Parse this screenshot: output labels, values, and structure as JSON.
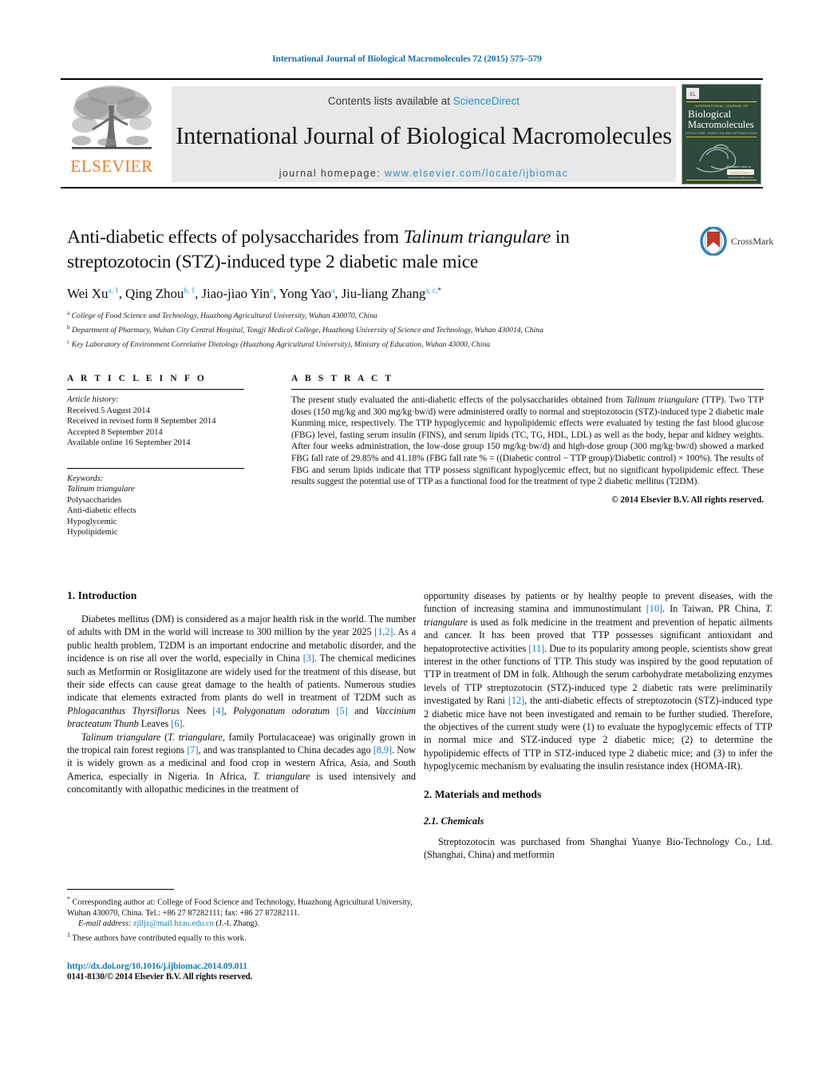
{
  "running_head": "International Journal of Biological Macromolecules 72 (2015) 575–579",
  "masthead": {
    "publisher_name": "ELSEVIER",
    "contents_prefix": "Contents lists available at",
    "contents_link": "ScienceDirect",
    "journal_title": "International Journal of Biological Macromolecules",
    "homepage_prefix": "journal homepage:",
    "homepage_url": "www.elsevier.com/locate/ijbiomac",
    "cover_line1": "INTERNATIONAL JOURNAL OF",
    "cover_line2": "Biological",
    "cover_line3": "Macromolecules",
    "cover_line4": "STRUCTURE, FUNCTION AND INTERACTIONS",
    "cover_footer": "ScienceDirect",
    "cover_footer_sub": "www.sciencedirect.com",
    "accent_link_color": "#2a93c8",
    "elsevier_orange": "#ef7d22",
    "cover_bg_color": "#2e4a3c"
  },
  "crossmark": {
    "label": "CrossMark"
  },
  "article": {
    "title_part1": "Anti-diabetic effects of polysaccharides from ",
    "title_italic": "Talinum triangulare",
    "title_part2": " in streptozotocin (STZ)-induced type 2 diabetic male mice",
    "authors_html": "Wei Xu<sup>a, 1</sup>, Qing Zhou<sup>b, 1</sup>, Jiao-jiao Yin<sup>a</sup>, Yong Yao<sup>a</sup>, Jiu-liang Zhang<sup>a, c,<span class=\"blk\">*</span></sup>",
    "affiliations": [
      {
        "marker": "a",
        "text": "College of Food Science and Technology, Huazhong Agricultural University, Wuhan 430070, China"
      },
      {
        "marker": "b",
        "text": "Department of Pharmacy, Wuhan City Central Hospital, Tongji Medical College, Huazhong University of Science and Technology, Wuhan 430014, China"
      },
      {
        "marker": "c",
        "text": "Key Laboratory of Environment Correlative Dietology (Huazhong Agricultural University), Ministry of Education, Wuhan 43000, China"
      }
    ]
  },
  "article_info": {
    "heading": "A R T I C L E    I N F O",
    "history_label": "Article history:",
    "history": [
      "Received 5 August 2014",
      "Received in revised form 8 September 2014",
      "Accepted 8 September 2014",
      "Available online 16 September 2014"
    ],
    "keywords_label": "Keywords:",
    "keywords": [
      "Talinum triangulare",
      "Polysaccharides",
      "Anti-diabetic effects",
      "Hypoglycemic",
      "Hypolipidemic"
    ]
  },
  "abstract": {
    "heading": "A B S T R A C T",
    "body_html": "The present study evaluated the anti-diabetic effects of the polysaccharides obtained from <i>Talinum triangulare</i> (TTP). Two TTP doses (150 mg/kg and 300 mg/kg·bw/d) were administered orally to normal and streptozotocin (STZ)-induced type 2 diabetic male Kunming mice, respectively. The TTP hypoglycemic and hypolipidemic effects were evaluated by testing the fast blood glucose (FBG) level, fasting serum insulin (FINS), and serum lipids (TC, TG, HDL, LDL) as well as the body, hepar and kidney weights. After four weeks administration, the low-dose group 150 mg/kg·bw/d) and high-dose group (300 mg/kg·bw/d) showed a marked FBG fall rate of 29.85% and 41.18% (FBG fall rate % = ((Diabetic control − TTP group)/Diabetic control) × 100%). The results of FBG and serum lipids indicate that TTP possess significant hypoglycemic effect, but no significant hypolipidemic effect. These results suggest the potential use of TTP as a functional food for the treatment of type 2 diabetic mellitus (T2DM).",
    "copyright": "© 2014 Elsevier B.V. All rights reserved."
  },
  "sections": {
    "introduction_heading": "1.  Introduction",
    "intro_p1_html": "Diabetes mellitus (DM) is considered as a major health risk in the world. The number of adults with DM in the world will increase to 300 million by the year 2025 <span class=\"ref\">[1,2]</span>. As a public health problem, T2DM is an important endocrine and metabolic disorder, and the incidence is on rise all over the world, especially in China <span class=\"ref\">[3]</span>. The chemical medicines such as Metformin or Rosiglitazone are widely used for the treatment of this disease, but their side effects can cause great damage to the health of patients. Numerous studies indicate that elements extracted from plants do well in treatment of T2DM such as <i>Phlogacanthus Thyrsiflorus</i> Nees <span class=\"ref\">[4]</span>, <i>Polygonatum odoratum</i> <span class=\"ref\">[5]</span> and <i>Vaccinium bracteatum Thunb</i> Leaves <span class=\"ref\">[6]</span>.",
    "intro_p2_html": "<i>Talinum triangulare</i> (<i>T. triangulare</i>, family Portulacaceae) was originally grown in the tropical rain forest regions <span class=\"ref\">[7]</span>, and was transplanted to China decades ago <span class=\"ref\">[8,9]</span>. Now it is widely grown as a medicinal and food crop in western Africa, Asia, and South America, especially in Nigeria. In Africa, <i>T. triangulare</i> is used intensively and concomitantly with allopathic medicines in the treatment of",
    "intro_p2_cont_html": "opportunity diseases by patients or by healthy people to prevent diseases, with the function of increasing stamina and immunostimulant <span class=\"ref\">[10]</span>. In Taiwan, PR China, <i>T. triangulare</i> is used as folk medicine in the treatment and prevention of hepatic ailments and cancer. It has been proved that TTP possesses significant antioxidant and hepatoprotective activities <span class=\"ref\">[11]</span>. Due to its popularity among people, scientists show great interest in the other functions of TTP. This study was inspired by the good reputation of TTP in treatment of DM in folk. Although the serum carbohydrate metabolizing enzymes levels of TTP streptozotocin (STZ)-induced type 2 diabetic rats were preliminarily investigated by Rani <span class=\"ref\">[12]</span>, the anti-diabetic effects of streptozotocin (STZ)-induced type 2 diabetic mice have not been investigated and remain to be further studied. Therefore, the objectives of the current study were (1) to evaluate the hypoglycemic effects of TTP in normal mice and STZ-induced type 2 diabetic mice; (2) to determine the hypolipidemic effects of TTP in STZ-induced type 2 diabetic mice; and (3) to infer the hypoglycemic mechanism by evaluating the insulin resistance index (HOMA-IR).",
    "materials_heading": "2.  Materials and methods",
    "chemicals_heading": "2.1.  Chemicals",
    "chemicals_p1": "Streptozotocin was purchased from Shanghai Yuanye Bio-Technology Co., Ltd. (Shanghai, China) and metformin"
  },
  "footnotes": {
    "corresponding_html": "<span class=\"fn-sup\">*</span>  Corresponding author at: College of Food Science and Technology, Huazhong Agricultural University, Wuhan 430070, China. Tel.: +86 27 87282111; fax: +86 27 87282111.",
    "email_label": "E-mail address:",
    "email": "zjlljz@mail.hzau.edu.cn",
    "email_suffix": "(J.-l. Zhang).",
    "equal_contrib_html": "<span class=\"fn-sup\">1</span>  These authors have contributed equally to this work."
  },
  "footer": {
    "doi": "http://dx.doi.org/10.1016/j.ijbiomac.2014.09.011",
    "issn": "0141-8130/© 2014 Elsevier B.V. All rights reserved."
  }
}
